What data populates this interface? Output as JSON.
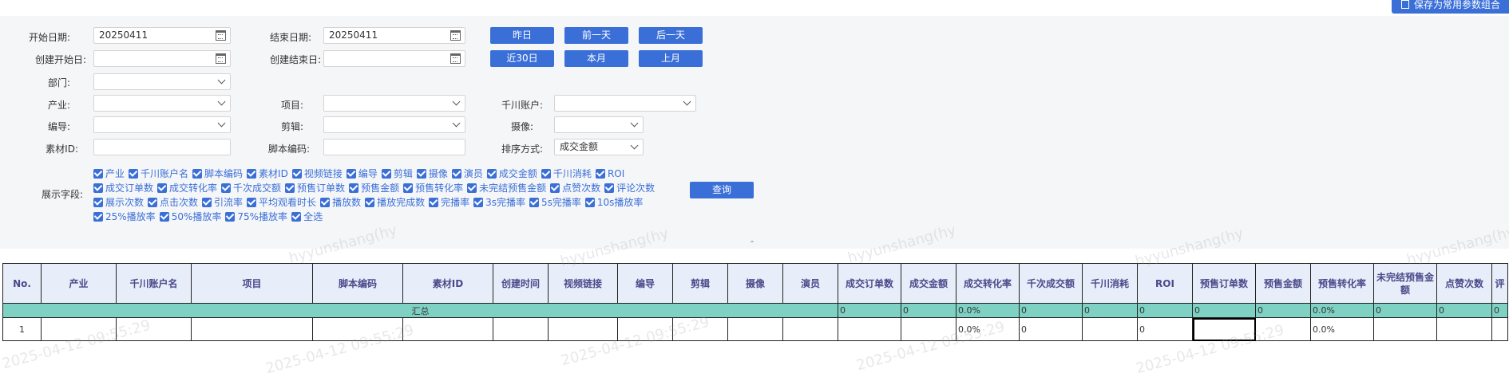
{
  "toolbar": {
    "save_label": "保存为常用参数组合"
  },
  "filters": {
    "start_date": {
      "label": "开始日期:",
      "value": "20250411"
    },
    "end_date": {
      "label": "结束日期:",
      "value": "20250411"
    },
    "create_start": {
      "label": "创建开始日:",
      "value": ""
    },
    "create_end": {
      "label": "创建结束日:",
      "value": ""
    },
    "department": {
      "label": "部门:",
      "value": ""
    },
    "industry": {
      "label": "产业:",
      "value": ""
    },
    "project": {
      "label": "项目:",
      "value": ""
    },
    "qianchuan_account": {
      "label": "千川账户:",
      "value": ""
    },
    "director": {
      "label": "编导:",
      "value": ""
    },
    "editor": {
      "label": "剪辑:",
      "value": ""
    },
    "camera": {
      "label": "摄像:",
      "value": ""
    },
    "material_id": {
      "label": "素材ID:",
      "value": ""
    },
    "script_code": {
      "label": "脚本编码:",
      "value": ""
    },
    "sort": {
      "label": "排序方式:",
      "value": "成交金额"
    }
  },
  "date_buttons": {
    "yesterday": "昨日",
    "prev_day": "前一天",
    "next_day": "后一天",
    "last30": "近30日",
    "this_month": "本月",
    "last_month": "上月"
  },
  "display_fields": {
    "label": "展示字段:",
    "rows": [
      [
        "产业",
        "千川账户名",
        "脚本编码",
        "素材ID",
        "视频链接",
        "编导",
        "剪辑",
        "摄像",
        "演员",
        "成交金额",
        "千川消耗",
        "ROI"
      ],
      [
        "成交订单数",
        "成交转化率",
        "千次成交额",
        "预售订单数",
        "预售金额",
        "预售转化率",
        "未完结预售金额",
        "点赞次数",
        "评论次数"
      ],
      [
        "展示次数",
        "点击次数",
        "引流率",
        "平均观看时长",
        "播放数",
        "播放完成数",
        "完播率",
        "3s完播率",
        "5s完播率",
        "10s播放率"
      ],
      [
        "25%播放率",
        "50%播放率",
        "75%播放率",
        "全选"
      ]
    ]
  },
  "query_label": "查询",
  "collapse_icon": "chevron-up-double-icon",
  "table": {
    "columns": [
      "No.",
      "产业",
      "千川账户名",
      "项目",
      "脚本编码",
      "素材ID",
      "创建时间",
      "视频链接",
      "编导",
      "剪辑",
      "摄像",
      "演员",
      "成交订单数",
      "成交金额",
      "成交转化率",
      "千次成交额",
      "千川消耗",
      "ROI",
      "预售订单数",
      "预售金额",
      "预售转化率",
      "未完结预售金额",
      "点赞次数",
      "评"
    ],
    "summary": {
      "label": "汇总",
      "values": [
        "0",
        "0",
        "0.0%",
        "0",
        "0",
        "0",
        "0",
        "0",
        "0.0%",
        "0",
        "0",
        "0"
      ]
    },
    "rows": [
      [
        "1",
        "",
        "",
        "",
        "",
        "",
        "",
        "",
        "",
        "",
        "",
        "",
        "",
        "",
        "0.0%",
        "0",
        "",
        "0",
        "",
        "",
        "0.0%",
        "",
        "",
        ""
      ]
    ]
  },
  "watermark": {
    "text1": "hyyunshang(hy",
    "text2": "2025-04-12 09:55:29"
  },
  "colors": {
    "accent": "#3a6fd8",
    "summary_row": "#7fd1c3",
    "panel_bg": "#f5f6f8"
  }
}
